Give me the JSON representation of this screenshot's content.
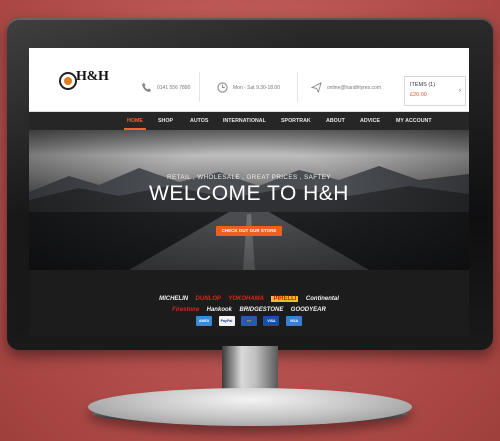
{
  "header": {
    "logo_text": "H&H",
    "logo_tagline": "",
    "phone": "0141 556 7890",
    "hours": "Mon - Sat 9.30-18.00",
    "email": "online@handhtyres.com",
    "cart": {
      "items_label": "ITEMS (1)",
      "total": "£26.00",
      "arrow": "›"
    }
  },
  "nav": {
    "items": [
      {
        "label": "HOME"
      },
      {
        "label": "SHOP"
      },
      {
        "label": "AUTOS"
      },
      {
        "label": "INTERNATIONAL"
      },
      {
        "label": "SPORTRAK"
      },
      {
        "label": "ABOUT"
      },
      {
        "label": "ADVICE"
      },
      {
        "label": "MY ACCOUNT"
      }
    ],
    "active_color": "#f0642c"
  },
  "hero": {
    "tagline": "RETAIL , WHOLESALE , GREAT PRICES , SAFTEY",
    "title": "WELCOME TO H&H",
    "cta_label": "CHECK OUT OUR STORE"
  },
  "brands": {
    "row1": [
      "MICHELIN",
      "DUNLOP",
      "YOKOHAMA",
      "PIRELLI",
      "Continental"
    ],
    "row2": [
      "Firestone",
      "Hankook",
      "BRIDGESTONE",
      "GOODYEAR"
    ]
  },
  "payments": [
    {
      "name": "American Express",
      "label": "AMEX",
      "color": "#3a8ad6"
    },
    {
      "name": "PayPal",
      "label": "PayPal",
      "color": "#f2f2f2"
    },
    {
      "name": "Maestro",
      "label": "●●",
      "color": "#2a5aa8"
    },
    {
      "name": "Visa",
      "label": "VISA",
      "color": "#1d4fa0"
    },
    {
      "name": "Visa Electron",
      "label": "VISA",
      "color": "#3a7fd0"
    }
  ],
  "colors": {
    "accent": "#ee5e1f",
    "background": "#b4504d"
  }
}
